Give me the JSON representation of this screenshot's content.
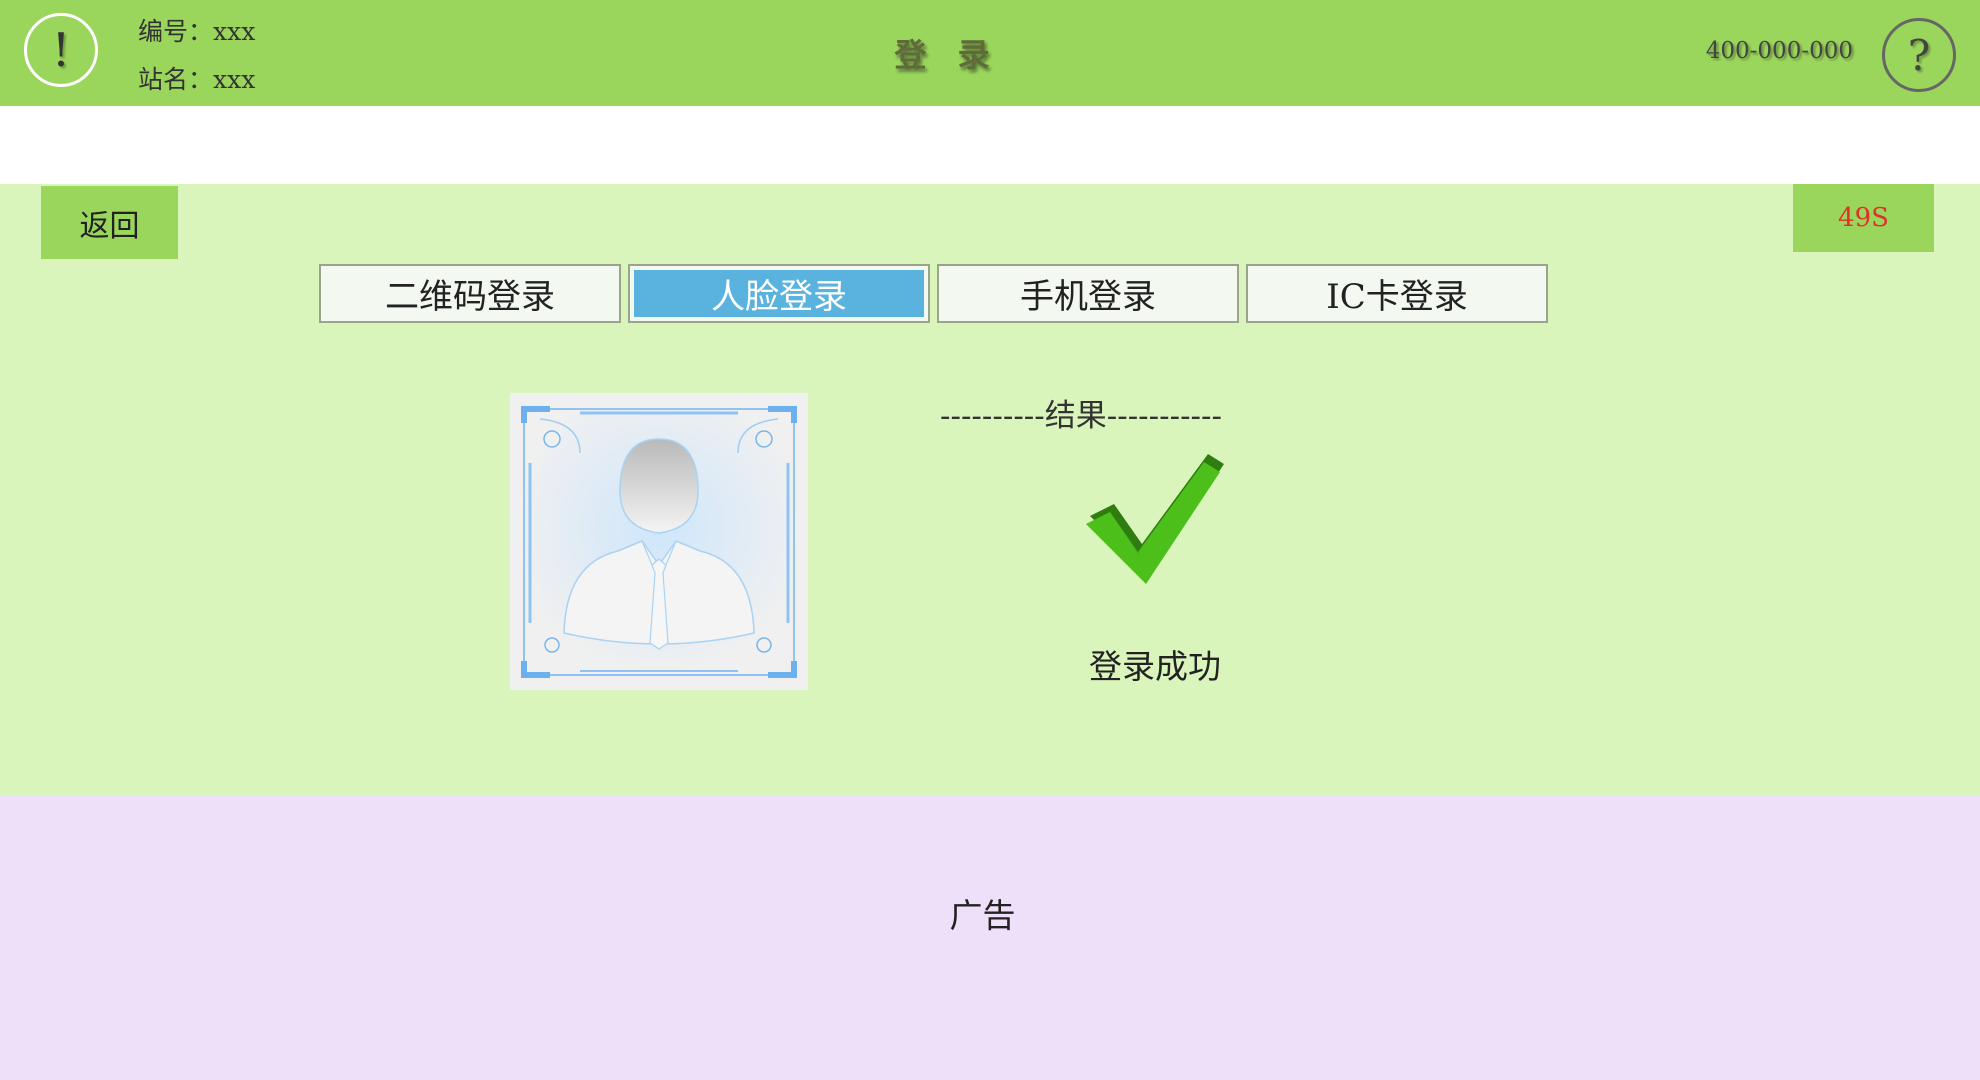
{
  "header": {
    "station_no": "编号：xxx",
    "station_name": "站名：xxx",
    "title": "登 录",
    "phone": "400-000-000",
    "alert_symbol": "!",
    "help_symbol": "?"
  },
  "main": {
    "back_label": "返回",
    "countdown": "49S",
    "tabs": [
      {
        "label": "二维码登录",
        "active": false
      },
      {
        "label": "人脸登录",
        "active": true
      },
      {
        "label": "手机登录",
        "active": false
      },
      {
        "label": "IC卡登录",
        "active": false
      }
    ],
    "result_title": "----------结果-----------",
    "result_text": "登录成功",
    "face_icon": "face-scan-avatar-icon",
    "result_icon": "checkmark-icon"
  },
  "ad": {
    "label": "广告"
  },
  "colors": {
    "header_bg": "#9bd65c",
    "main_bg": "#daf5bb",
    "ad_bg": "#ede0f8",
    "active_tab": "#5ab3de",
    "countdown_text": "#e0302a",
    "check_green": "#4cbf1a"
  }
}
